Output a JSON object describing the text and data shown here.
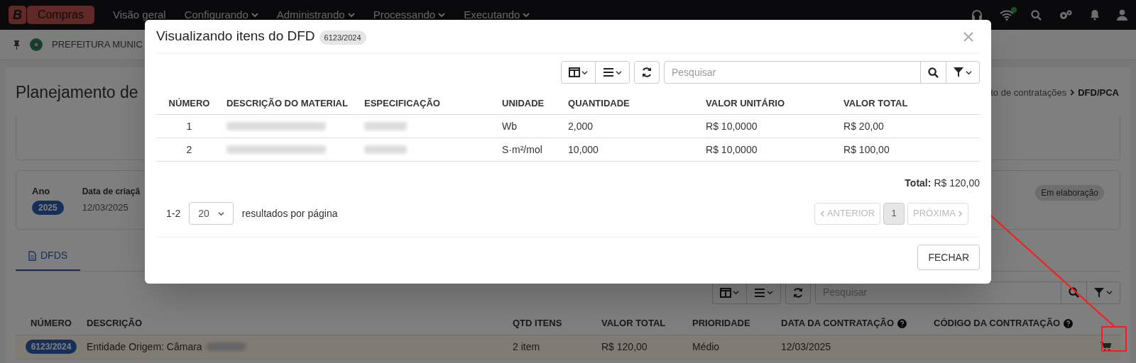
{
  "navbar": {
    "logo_letter": "B",
    "app_name": "Compras",
    "menu": [
      {
        "label": "Visão geral",
        "dropdown": false
      },
      {
        "label": "Configurando",
        "dropdown": true
      },
      {
        "label": "Administrando",
        "dropdown": true
      },
      {
        "label": "Processando",
        "dropdown": true
      },
      {
        "label": "Executando",
        "dropdown": true
      }
    ],
    "connected": true
  },
  "context_bar": {
    "organization": "PREFEITURA MUNIC"
  },
  "page": {
    "title": "Planejamento de",
    "breadcrumb": [
      {
        "label": "to de contratações",
        "current": false
      },
      {
        "label": "DFD/PCA",
        "current": true
      }
    ],
    "summary": {
      "year_label": "Ano",
      "year": "2025",
      "created_label": "Data de criaçã",
      "created": "12/03/2025",
      "status": "Em elaboração"
    },
    "tabs": [
      {
        "label": "DFDS",
        "selected": true
      }
    ],
    "search": {
      "placeholder": "Pesquisar"
    },
    "table": {
      "columns": [
        {
          "label": "NÚMERO",
          "help": false
        },
        {
          "label": "DESCRIÇÃO",
          "help": false
        },
        {
          "label": "QTD ITENS",
          "help": false
        },
        {
          "label": "VALOR TOTAL",
          "help": false
        },
        {
          "label": "PRIORIDADE",
          "help": false
        },
        {
          "label": "DATA DA CONTRATAÇÃO",
          "help": true
        },
        {
          "label": "CÓDIGO DA CONTRATAÇÃO",
          "help": true
        }
      ],
      "rows": [
        {
          "number": "6123/2024",
          "description": "Entidade Origem: Câmara",
          "redacted": true,
          "items": "2 item",
          "total": "R$ 120,00",
          "priority": "Médio",
          "date": "12/03/2025",
          "code": "",
          "selected": true
        }
      ]
    }
  },
  "modal": {
    "title": "Visualizando itens do DFD",
    "badge": "6123/2024",
    "search": {
      "placeholder": "Pesquisar"
    },
    "columns": [
      "NÚMERO",
      "DESCRIÇÃO DO MATERIAL",
      "ESPECIFICAÇÃO",
      "UNIDADE",
      "QUANTIDADE",
      "VALOR UNITÁRIO",
      "VALOR TOTAL"
    ],
    "rows": [
      {
        "number": "1",
        "unit": "Wb",
        "quantity": "2,000",
        "unit_price": "R$ 10,0000",
        "total": "R$ 20,00"
      },
      {
        "number": "2",
        "unit": "S·m²/mol",
        "quantity": "10,000",
        "unit_price": "R$ 10,0000",
        "total": "R$ 100,00"
      }
    ],
    "total_label": "Total:",
    "total": "R$ 120,00",
    "range": "1-2",
    "page_size": "20",
    "page_size_label": "resultados por página",
    "pagination": [
      {
        "label": "ANTERIOR",
        "kind": "prev",
        "disabled": true,
        "selected": false
      },
      {
        "label": "1",
        "kind": "page",
        "disabled": false,
        "selected": true
      },
      {
        "label": "PRÓXIMA",
        "kind": "next",
        "disabled": true,
        "selected": false
      }
    ],
    "close_button": "FECHAR"
  }
}
